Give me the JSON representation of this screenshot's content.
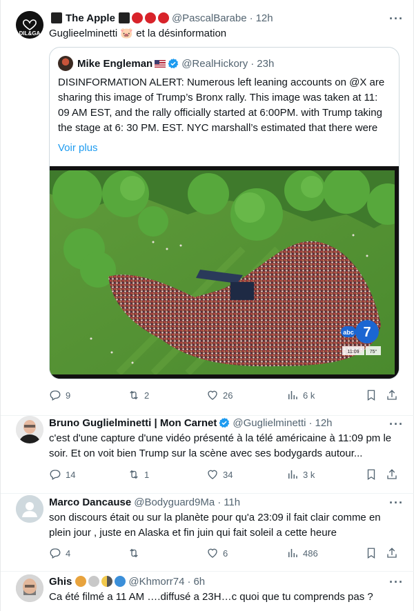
{
  "tweets": [
    {
      "name": "The Apple",
      "handle": "@PascalBarabe",
      "time": "12h",
      "avatar_text": "DIL&GA",
      "text": "Guglieelminetti 🐷 et la désinformation",
      "quote": {
        "name": "Mike Engleman",
        "handle": "@RealHickory",
        "time": "23h",
        "text": "DISINFORMATION ALERT: Numerous left leaning accounts on @X are sharing this image of Trump’s Bronx rally. This image was taken at 11: 09 AM EST, and the rally officially started at 6:00PM. with Trump taking the stage at 6: 30 PM. EST. NYC marshall’s estimated that there were",
        "more": "Voir plus",
        "tv_time": "11:09",
        "tv_temp": "75°",
        "tv_logo": "abc"
      },
      "stats": {
        "replies": "9",
        "retweets": "2",
        "likes": "26",
        "views": "6 k"
      }
    },
    {
      "name": "Bruno Guglielminetti | Mon Carnet",
      "handle": "@Guglielminetti",
      "time": "12h",
      "text": "c'est d'une capture d'une vidéo présenté à la télé américaine à 11:09 pm le soir. Et on voit bien Trump sur la scène avec ses bodygards autour...",
      "stats": {
        "replies": "14",
        "retweets": "1",
        "likes": "34",
        "views": "3 k"
      }
    },
    {
      "name": "Marco Dancause",
      "handle": "@Bodyguard9Ma",
      "time": "11h",
      "text": "son discours était ou sur la planète pour qu'a 23:09 il fait clair comme en plein jour , juste en Alaska et fin juin qui fait soleil a cette heure",
      "stats": {
        "replies": "4",
        "retweets": "",
        "likes": "6",
        "views": "486"
      }
    },
    {
      "name": "Ghis",
      "handle": "@Khmorr74",
      "time": "6h",
      "text": "Ca été filmé a 11 AM ….diffusé a 23H…c quoi que tu comprends pas ?"
    }
  ],
  "colors": {
    "accent": "#1d9bf0",
    "muted": "#536471",
    "text": "#0f1419",
    "border": "#cfd9de"
  }
}
